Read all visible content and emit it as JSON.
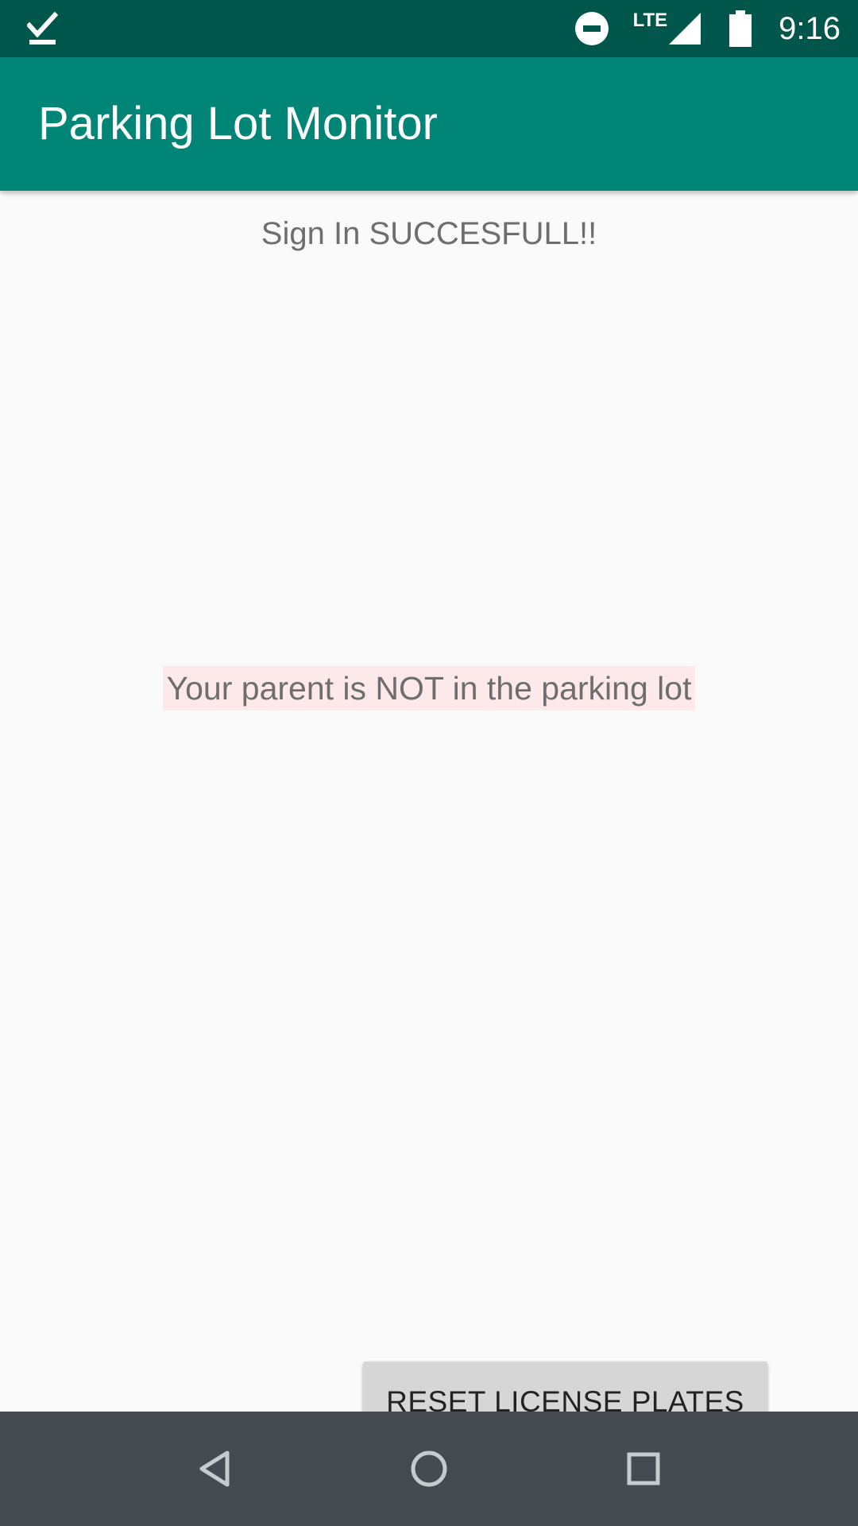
{
  "status_bar": {
    "left_icon": "checkmark-icon",
    "network_label": "LTE",
    "time": "9:16",
    "icons": [
      "do-not-disturb-icon",
      "signal-icon",
      "battery-icon"
    ]
  },
  "app_bar": {
    "title": "Parking Lot Monitor",
    "color": "#008577"
  },
  "main": {
    "signin_message": "Sign In SUCCESFULL!!",
    "parent_status": "Your parent is NOT in the parking lot",
    "reset_button_label": "RESET LICENSE PLATES"
  },
  "nav_bar": {
    "icons": [
      "back-icon",
      "home-icon",
      "recents-icon"
    ]
  },
  "colors": {
    "status_bar": "#00564b",
    "app_bar": "#008577",
    "background": "#fafafa",
    "status_highlight": "#fde9e9",
    "nav_bar": "#454b51"
  }
}
